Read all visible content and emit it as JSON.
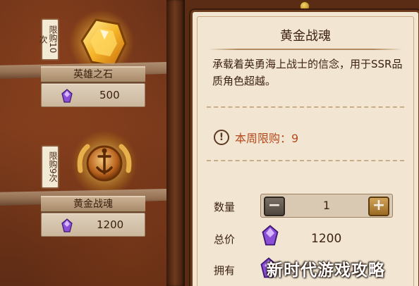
{
  "shop_items": [
    {
      "limit_tag": "限购10次",
      "name": "英雄之石",
      "price": "500",
      "icon": "yellow-gem-icon",
      "currency_icon": "purple-crystal-icon"
    },
    {
      "limit_tag": "限购9次",
      "name": "黄金战魂",
      "price": "1200",
      "icon": "golden-anchor-emblem-icon",
      "currency_icon": "purple-crystal-icon"
    }
  ],
  "detail": {
    "title": "黄金战魂",
    "description": "承载着英勇海上战士的信念，用于SSR品质角色超越。",
    "weekly_limit": "本周限购：9",
    "quantity_label": "数量",
    "quantity_value": "1",
    "minus_label": "−",
    "plus_label": "+",
    "total_label": "总价",
    "total_value": "1200",
    "own_label": "拥有"
  },
  "watermark": "新时代游戏攻略",
  "colors": {
    "panel_bg": "#f2e6d3",
    "wood": "#6b3219",
    "limit_text": "#b44a1e",
    "crystal": "#8a4fd6"
  }
}
